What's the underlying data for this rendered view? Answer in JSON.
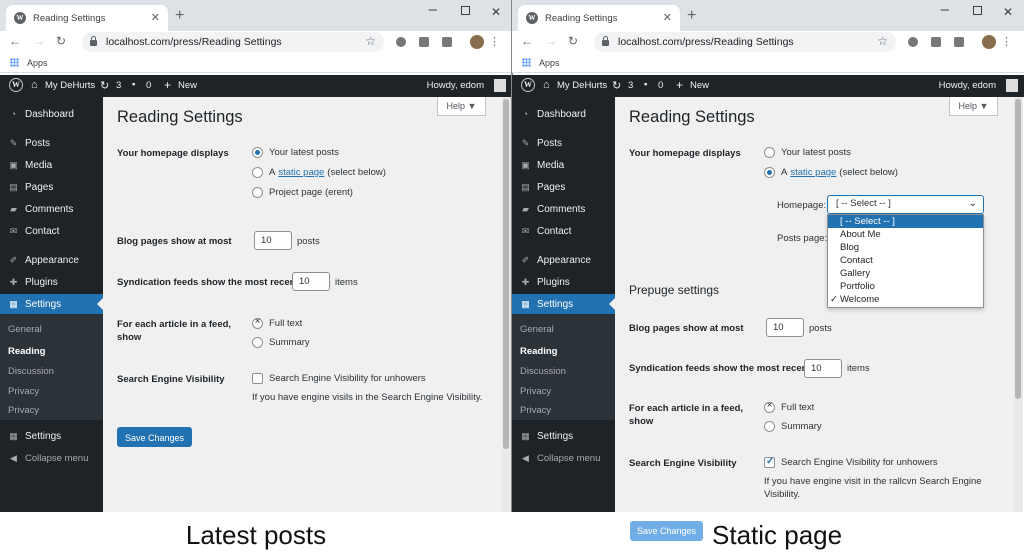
{
  "browser": {
    "tab_title": "Reading Settings",
    "favicon": "W",
    "url": "localhost.com/press/Reading Settings",
    "bookmark": "Apps",
    "tab_close": "✕",
    "new_tab": "+"
  },
  "adminbar": {
    "site_name": "My DeHurts",
    "updates": "3",
    "comments": "0",
    "new_label": "New",
    "howdy": "Howdy, edom"
  },
  "sidebar": {
    "items": [
      "Dashboard",
      "Posts",
      "Media",
      "Pages",
      "Comments",
      "Contact",
      "Appearance",
      "Plugins",
      "Settings"
    ],
    "submenu": [
      "General",
      "Reading",
      "Discussion",
      "Privacy",
      "Privacy"
    ],
    "settings_again": "Settings",
    "collapse": "Collapse menu"
  },
  "left": {
    "help": "Help ▼",
    "title": "Reading Settings",
    "homepage_label": "Your homepage displays",
    "opt_latest": "Your latest posts",
    "opt_static_prefix": "A",
    "opt_static_link": "static page",
    "opt_static_suffix": "(select below)",
    "opt_project": "Project page (erent)",
    "blog_label": "Blog pages show at most",
    "blog_value": "10",
    "blog_unit": "posts",
    "synd_label": "Syndication feeds show the most recent",
    "synd_value": "10",
    "synd_unit": "items",
    "feed_label": "For each article in a feed, show",
    "feed_full": "Full text",
    "feed_summary": "Summary",
    "sev_label": "Search Engine Visibility",
    "sev_checkbox": "Search Engine Visibility for unhowers",
    "sev_desc": "If you have engine visils in the Search Engine Visibility.",
    "save": "Save Changes",
    "caption": "Latest posts"
  },
  "right": {
    "help": "Help ▼",
    "title": "Reading Settings",
    "homepage_label": "Your homepage displays",
    "opt_latest": "Your latest posts",
    "opt_static_prefix": "A",
    "opt_static_link": "static page",
    "opt_static_suffix": "(select below)",
    "homepage_select_label": "Homepage:",
    "posts_page_label": "Posts page:",
    "select_value": "[ -- Select -- ]",
    "options": [
      "[ -- Select -- ]",
      "About Me",
      "Blog",
      "Contact",
      "Gallery",
      "Portfolio",
      "Welcome"
    ],
    "checked_option_mark": "✓",
    "section": "Prepuge settings",
    "blog_label": "Blog pages show at most",
    "blog_value": "10",
    "blog_unit": "posts",
    "synd_label": "Syndication feeds show the most recent",
    "synd_value": "10",
    "synd_unit": "items",
    "feed_label": "For each article in a feed, show",
    "feed_full": "Full text",
    "feed_summary": "Summary",
    "sev_label": "Search Engine Visibility",
    "sev_checkbox": "Search Engine Visibility for unhowers",
    "sev_desc": "If you have engine visit in the rallcvn Search Engine Visibility.",
    "save": "Save Changes",
    "caption": "Static page"
  },
  "colors": {
    "accent": "#2271b1",
    "admin_dark": "#1d2327",
    "content_bg": "#f0f0f1"
  }
}
